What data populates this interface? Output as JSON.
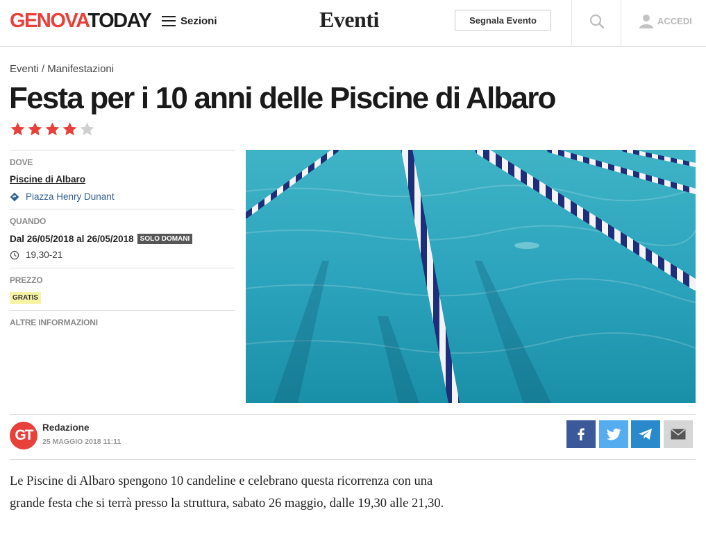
{
  "header": {
    "logo_part1": "GENOVA",
    "logo_part2": "TODAY",
    "menu_label": "Sezioni",
    "section_title": "Eventi",
    "report_button": "Segnala Evento",
    "login_label": "ACCEDI",
    "icons": [
      "hamburger-icon",
      "search-icon",
      "user-icon"
    ]
  },
  "breadcrumb": {
    "item1": "Eventi",
    "separator": "/",
    "item2": "Manifestazioni"
  },
  "event": {
    "title": "Festa per i 10 anni delle Piscine di Albaro",
    "rating": 4,
    "rating_max": 5,
    "where_label": "DOVE",
    "venue": "Piscine di Albaro",
    "address": "Piazza Henry Dunant",
    "when_label": "QUANDO",
    "dates": "Dal 26/05/2018 al 26/05/2018",
    "dates_badge": "SOLO DOMANI",
    "time": "19,30-21",
    "price_label": "PREZZO",
    "price_badge": "GRATIS",
    "other_label": "ALTRE INFORMAZIONI"
  },
  "author": {
    "avatar_text": "GT",
    "name": "Redazione",
    "date": "25 MAGGIO 2018 11:11"
  },
  "share": [
    "facebook-icon",
    "twitter-icon",
    "telegram-icon",
    "email-icon"
  ],
  "body": {
    "paragraph": "Le Piscine di Albaro spengono 10 candeline e celebrano questa ricorrenza con una grande festa che si terrà presso la struttura, sabato 26 maggio, dalle 19,30 alle 21,30."
  },
  "colors": {
    "brand_red": "#e8403a",
    "star_on": "#e8403a",
    "star_off": "#d0d0d0",
    "facebook": "#3b5998",
    "twitter": "#55acee",
    "telegram": "#2a89cb"
  }
}
